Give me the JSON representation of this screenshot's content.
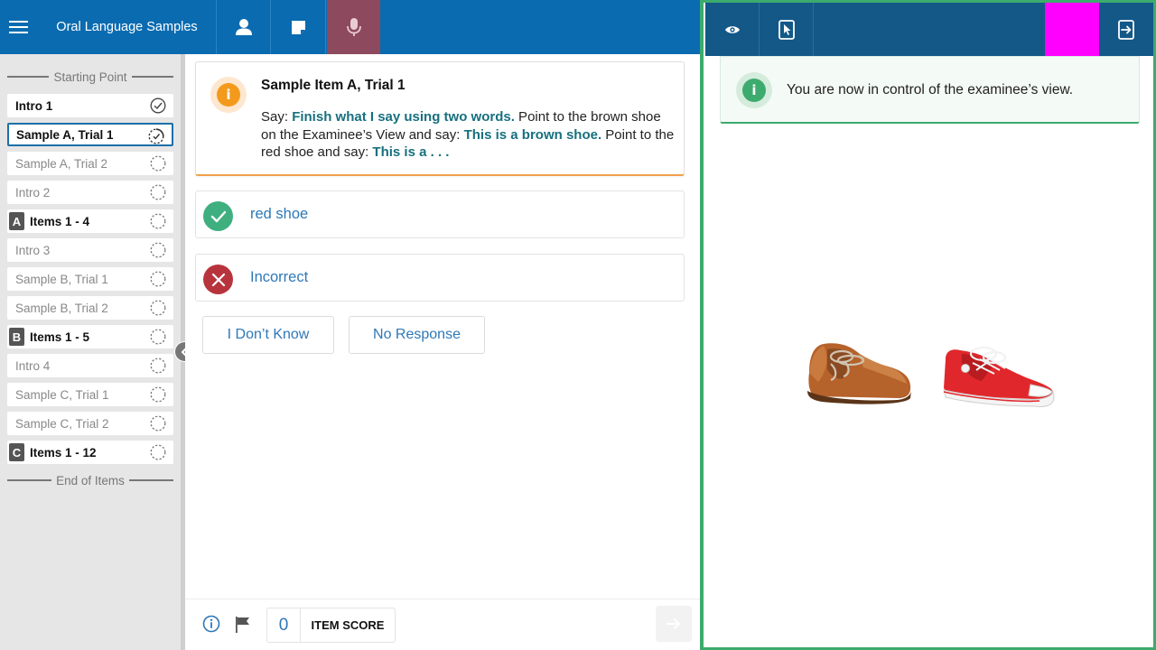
{
  "header": {
    "app_title": "Oral Language Samples",
    "icons": [
      "menu-icon",
      "person-icon",
      "note-icon",
      "microphone-icon"
    ]
  },
  "sidebar": {
    "start_marker": "Starting Point",
    "end_marker": "End of Items",
    "items": [
      {
        "label": "Intro 1",
        "badge": "",
        "status": "completed"
      },
      {
        "label": "Sample A, Trial 1",
        "badge": "",
        "status": "in-progress"
      },
      {
        "label": "Sample A, Trial 2",
        "badge": "",
        "status": "not-started"
      },
      {
        "label": "Intro 2",
        "badge": "",
        "status": "not-started"
      },
      {
        "label": "Items 1 - 4",
        "badge": "A",
        "status": "not-started"
      },
      {
        "label": "Intro 3",
        "badge": "",
        "status": "not-started"
      },
      {
        "label": "Sample B, Trial 1",
        "badge": "",
        "status": "not-started"
      },
      {
        "label": "Sample B, Trial 2",
        "badge": "",
        "status": "not-started"
      },
      {
        "label": "Items 1 - 5",
        "badge": "B",
        "status": "not-started"
      },
      {
        "label": "Intro 4",
        "badge": "",
        "status": "not-started"
      },
      {
        "label": "Sample C, Trial 1",
        "badge": "",
        "status": "not-started"
      },
      {
        "label": "Sample C, Trial 2",
        "badge": "",
        "status": "not-started"
      },
      {
        "label": "Items 1 - 12",
        "badge": "C",
        "status": "not-started"
      }
    ]
  },
  "instruction": {
    "title": "Sample Item A, Trial 1",
    "info_glyph": "i",
    "segments": [
      {
        "text": "Say: ",
        "said": false
      },
      {
        "text": "Finish what I say using two words.",
        "said": true
      },
      {
        "text": " Point to the brown shoe on the Examinee’s View and say: ",
        "said": false
      },
      {
        "text": "This is a brown shoe.",
        "said": true
      },
      {
        "text": " Point to the red shoe and say: ",
        "said": false
      },
      {
        "text": "This is a . . .",
        "said": true
      }
    ]
  },
  "responses": {
    "correct_label": "red shoe",
    "incorrect_label": "Incorrect",
    "dont_know_label": "I Don’t Know",
    "no_response_label": "No Response"
  },
  "footer": {
    "score_value": "0",
    "score_label": "ITEM SCORE"
  },
  "examinee_view": {
    "banner_glyph": "i",
    "banner_text": "You are now in control of the examinee’s view.",
    "icons": [
      "eye-icon",
      "tablet-pointer-icon",
      "exit-view-icon"
    ],
    "images": [
      "brown-shoe",
      "red-shoe"
    ]
  },
  "colors": {
    "app_blue": "#0a6bb0",
    "examinee_header": "#135887",
    "mic_active": "#8d4a5e",
    "said_text": "#17707f",
    "correct_green": "#3faf7f",
    "incorrect_red": "#b8343d",
    "warning_orange": "#f39a1c",
    "highlight": "#ff00ff"
  }
}
